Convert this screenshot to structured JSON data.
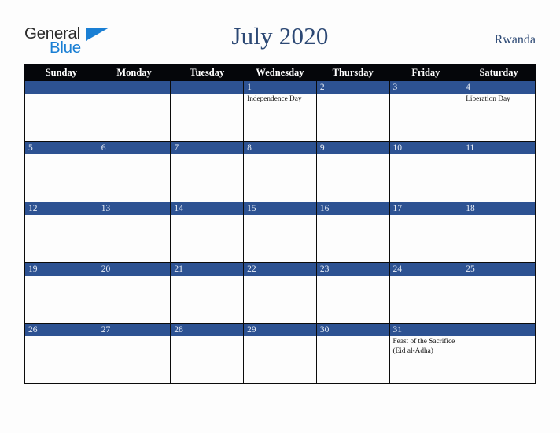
{
  "brand": {
    "name_part1": "General",
    "name_part2": "Blue",
    "triangle_icon": "triangle-icon",
    "color_dark": "#2b2b2b",
    "color_blue": "#1a7fd4"
  },
  "header": {
    "title": "July 2020",
    "country": "Rwanda",
    "title_color": "#2c4874"
  },
  "theme": {
    "header_row_bg": "#05060a",
    "day_bar_bg": "#2d5292",
    "page_bg": "#fdfdfd",
    "grid_line": "#0b0b0b"
  },
  "weekdays": [
    {
      "label": "Sunday"
    },
    {
      "label": "Monday"
    },
    {
      "label": "Tuesday"
    },
    {
      "label": "Wednesday"
    },
    {
      "label": "Thursday"
    },
    {
      "label": "Friday"
    },
    {
      "label": "Saturday"
    }
  ],
  "weeks": [
    [
      {
        "day": "",
        "events": []
      },
      {
        "day": "",
        "events": []
      },
      {
        "day": "",
        "events": []
      },
      {
        "day": "1",
        "events": [
          "Independence Day"
        ]
      },
      {
        "day": "2",
        "events": []
      },
      {
        "day": "3",
        "events": []
      },
      {
        "day": "4",
        "events": [
          "Liberation Day"
        ]
      }
    ],
    [
      {
        "day": "5",
        "events": []
      },
      {
        "day": "6",
        "events": []
      },
      {
        "day": "7",
        "events": []
      },
      {
        "day": "8",
        "events": []
      },
      {
        "day": "9",
        "events": []
      },
      {
        "day": "10",
        "events": []
      },
      {
        "day": "11",
        "events": []
      }
    ],
    [
      {
        "day": "12",
        "events": []
      },
      {
        "day": "13",
        "events": []
      },
      {
        "day": "14",
        "events": []
      },
      {
        "day": "15",
        "events": []
      },
      {
        "day": "16",
        "events": []
      },
      {
        "day": "17",
        "events": []
      },
      {
        "day": "18",
        "events": []
      }
    ],
    [
      {
        "day": "19",
        "events": []
      },
      {
        "day": "20",
        "events": []
      },
      {
        "day": "21",
        "events": []
      },
      {
        "day": "22",
        "events": []
      },
      {
        "day": "23",
        "events": []
      },
      {
        "day": "24",
        "events": []
      },
      {
        "day": "25",
        "events": []
      }
    ],
    [
      {
        "day": "26",
        "events": []
      },
      {
        "day": "27",
        "events": []
      },
      {
        "day": "28",
        "events": []
      },
      {
        "day": "29",
        "events": []
      },
      {
        "day": "30",
        "events": []
      },
      {
        "day": "31",
        "events": [
          "Feast of the Sacrifice (Eid al-Adha)"
        ]
      },
      {
        "day": "",
        "events": []
      }
    ]
  ]
}
